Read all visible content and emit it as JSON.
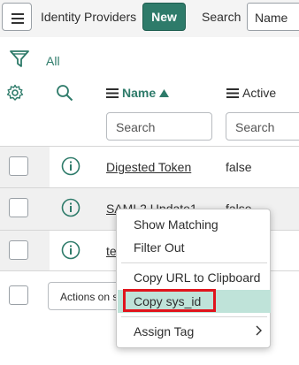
{
  "header": {
    "title": "Identity Providers",
    "new_label": "New",
    "search_label": "Search",
    "search_field": "Name"
  },
  "filter": {
    "all_label": "All"
  },
  "columns": {
    "name_label": "Name",
    "active_label": "Active",
    "name_search_placeholder": "Search",
    "active_search_placeholder": "Search"
  },
  "rows": [
    {
      "name": "Digested Token",
      "active": "false"
    },
    {
      "name": "SAML2 Update1",
      "active": "false"
    },
    {
      "name": "te",
      "active": ""
    }
  ],
  "actions": {
    "label": "Actions on s"
  },
  "context_menu": {
    "items": [
      "Show Matching",
      "Filter Out",
      "Copy URL to Clipboard",
      "Copy sys_id",
      "Assign Tag"
    ],
    "highlighted": "Copy sys_id"
  },
  "colors": {
    "accent": "#2e7b6a",
    "highlight": "#bfe3d9",
    "annotation_box": "#e0141c",
    "row_alt": "#f0f0f0"
  }
}
